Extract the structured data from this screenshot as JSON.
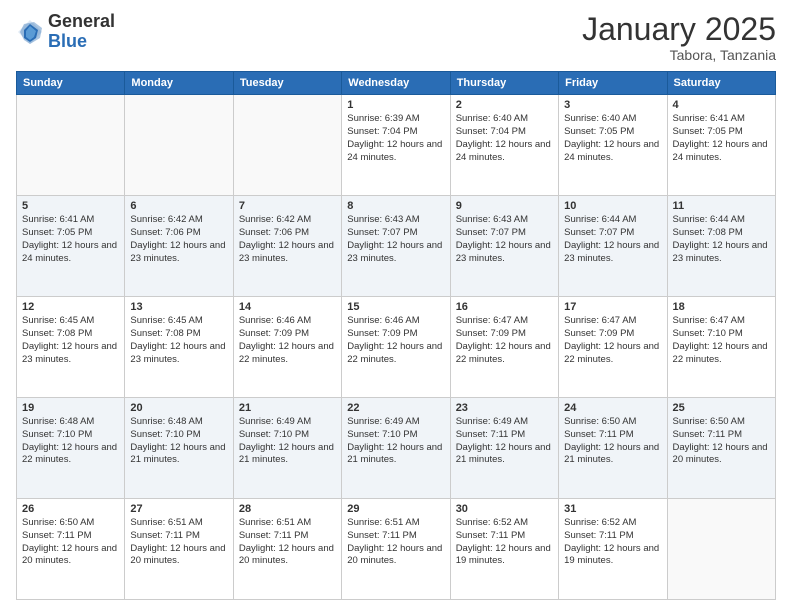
{
  "logo": {
    "general": "General",
    "blue": "Blue"
  },
  "header": {
    "month": "January 2025",
    "location": "Tabora, Tanzania"
  },
  "weekdays": [
    "Sunday",
    "Monday",
    "Tuesday",
    "Wednesday",
    "Thursday",
    "Friday",
    "Saturday"
  ],
  "weeks": [
    [
      {
        "day": "",
        "info": ""
      },
      {
        "day": "",
        "info": ""
      },
      {
        "day": "",
        "info": ""
      },
      {
        "day": "1",
        "info": "Sunrise: 6:39 AM\nSunset: 7:04 PM\nDaylight: 12 hours and 24 minutes."
      },
      {
        "day": "2",
        "info": "Sunrise: 6:40 AM\nSunset: 7:04 PM\nDaylight: 12 hours and 24 minutes."
      },
      {
        "day": "3",
        "info": "Sunrise: 6:40 AM\nSunset: 7:05 PM\nDaylight: 12 hours and 24 minutes."
      },
      {
        "day": "4",
        "info": "Sunrise: 6:41 AM\nSunset: 7:05 PM\nDaylight: 12 hours and 24 minutes."
      }
    ],
    [
      {
        "day": "5",
        "info": "Sunrise: 6:41 AM\nSunset: 7:05 PM\nDaylight: 12 hours and 24 minutes."
      },
      {
        "day": "6",
        "info": "Sunrise: 6:42 AM\nSunset: 7:06 PM\nDaylight: 12 hours and 23 minutes."
      },
      {
        "day": "7",
        "info": "Sunrise: 6:42 AM\nSunset: 7:06 PM\nDaylight: 12 hours and 23 minutes."
      },
      {
        "day": "8",
        "info": "Sunrise: 6:43 AM\nSunset: 7:07 PM\nDaylight: 12 hours and 23 minutes."
      },
      {
        "day": "9",
        "info": "Sunrise: 6:43 AM\nSunset: 7:07 PM\nDaylight: 12 hours and 23 minutes."
      },
      {
        "day": "10",
        "info": "Sunrise: 6:44 AM\nSunset: 7:07 PM\nDaylight: 12 hours and 23 minutes."
      },
      {
        "day": "11",
        "info": "Sunrise: 6:44 AM\nSunset: 7:08 PM\nDaylight: 12 hours and 23 minutes."
      }
    ],
    [
      {
        "day": "12",
        "info": "Sunrise: 6:45 AM\nSunset: 7:08 PM\nDaylight: 12 hours and 23 minutes."
      },
      {
        "day": "13",
        "info": "Sunrise: 6:45 AM\nSunset: 7:08 PM\nDaylight: 12 hours and 23 minutes."
      },
      {
        "day": "14",
        "info": "Sunrise: 6:46 AM\nSunset: 7:09 PM\nDaylight: 12 hours and 22 minutes."
      },
      {
        "day": "15",
        "info": "Sunrise: 6:46 AM\nSunset: 7:09 PM\nDaylight: 12 hours and 22 minutes."
      },
      {
        "day": "16",
        "info": "Sunrise: 6:47 AM\nSunset: 7:09 PM\nDaylight: 12 hours and 22 minutes."
      },
      {
        "day": "17",
        "info": "Sunrise: 6:47 AM\nSunset: 7:09 PM\nDaylight: 12 hours and 22 minutes."
      },
      {
        "day": "18",
        "info": "Sunrise: 6:47 AM\nSunset: 7:10 PM\nDaylight: 12 hours and 22 minutes."
      }
    ],
    [
      {
        "day": "19",
        "info": "Sunrise: 6:48 AM\nSunset: 7:10 PM\nDaylight: 12 hours and 22 minutes."
      },
      {
        "day": "20",
        "info": "Sunrise: 6:48 AM\nSunset: 7:10 PM\nDaylight: 12 hours and 21 minutes."
      },
      {
        "day": "21",
        "info": "Sunrise: 6:49 AM\nSunset: 7:10 PM\nDaylight: 12 hours and 21 minutes."
      },
      {
        "day": "22",
        "info": "Sunrise: 6:49 AM\nSunset: 7:10 PM\nDaylight: 12 hours and 21 minutes."
      },
      {
        "day": "23",
        "info": "Sunrise: 6:49 AM\nSunset: 7:11 PM\nDaylight: 12 hours and 21 minutes."
      },
      {
        "day": "24",
        "info": "Sunrise: 6:50 AM\nSunset: 7:11 PM\nDaylight: 12 hours and 21 minutes."
      },
      {
        "day": "25",
        "info": "Sunrise: 6:50 AM\nSunset: 7:11 PM\nDaylight: 12 hours and 20 minutes."
      }
    ],
    [
      {
        "day": "26",
        "info": "Sunrise: 6:50 AM\nSunset: 7:11 PM\nDaylight: 12 hours and 20 minutes."
      },
      {
        "day": "27",
        "info": "Sunrise: 6:51 AM\nSunset: 7:11 PM\nDaylight: 12 hours and 20 minutes."
      },
      {
        "day": "28",
        "info": "Sunrise: 6:51 AM\nSunset: 7:11 PM\nDaylight: 12 hours and 20 minutes."
      },
      {
        "day": "29",
        "info": "Sunrise: 6:51 AM\nSunset: 7:11 PM\nDaylight: 12 hours and 20 minutes."
      },
      {
        "day": "30",
        "info": "Sunrise: 6:52 AM\nSunset: 7:11 PM\nDaylight: 12 hours and 19 minutes."
      },
      {
        "day": "31",
        "info": "Sunrise: 6:52 AM\nSunset: 7:11 PM\nDaylight: 12 hours and 19 minutes."
      },
      {
        "day": "",
        "info": ""
      }
    ]
  ]
}
